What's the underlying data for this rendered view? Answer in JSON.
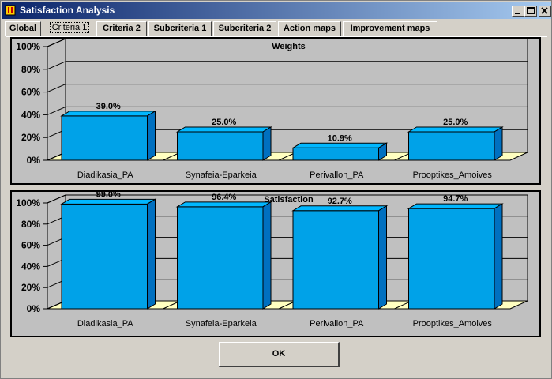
{
  "window": {
    "title": "Satisfaction Analysis"
  },
  "tabs": [
    {
      "label": "Global",
      "active": false
    },
    {
      "label": "Criteria 1",
      "active": true
    },
    {
      "label": "Criteria 2",
      "active": false
    },
    {
      "label": "Subcriteria 1",
      "active": false
    },
    {
      "label": "Subcriteria 2",
      "active": false
    },
    {
      "label": "Action maps",
      "active": false
    },
    {
      "label": "Improvement maps",
      "active": false
    }
  ],
  "ok_label": "OK",
  "colors": {
    "bar_front": "#00a2e8",
    "bar_top": "#00b7ff",
    "bar_side": "#0070c0",
    "floor": "#ffffc0",
    "chart_bg": "#c0c0c0"
  },
  "chart_data": [
    {
      "type": "bar",
      "title": "Weights",
      "categories": [
        "Diadikasia_PA",
        "Synafeia-Eparkeia",
        "Perivallon_PA",
        "Prooptikes_Amoives"
      ],
      "values": [
        39.0,
        25.0,
        10.9,
        25.0
      ],
      "value_labels": [
        "39.0%",
        "25.0%",
        "10.9%",
        "25.0%"
      ],
      "ylim": [
        0,
        100
      ],
      "yticks": [
        "0%",
        "20%",
        "40%",
        "60%",
        "80%",
        "100%"
      ],
      "grid": true
    },
    {
      "type": "bar",
      "title": "Satisfaction",
      "categories": [
        "Diadikasia_PA",
        "Synafeia-Eparkeia",
        "Perivallon_PA",
        "Prooptikes_Amoives"
      ],
      "values": [
        99.0,
        96.4,
        92.7,
        94.7
      ],
      "value_labels": [
        "99.0%",
        "96.4%",
        "92.7%",
        "94.7%"
      ],
      "ylim": [
        0,
        100
      ],
      "yticks": [
        "0%",
        "20%",
        "40%",
        "60%",
        "80%",
        "100%"
      ],
      "grid": true
    }
  ]
}
